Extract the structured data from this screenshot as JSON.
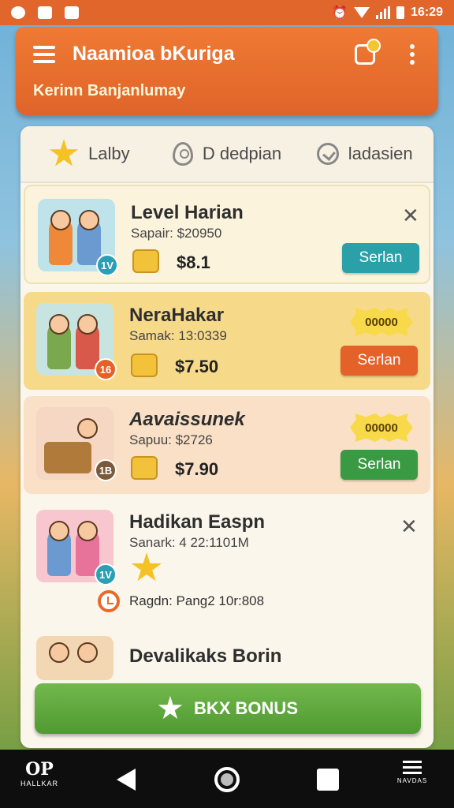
{
  "status_bar": {
    "time": "16:29"
  },
  "app_bar": {
    "title": "Naamioa bKuriga",
    "subtitle": "Kerinn Banjanlumay"
  },
  "tabs": [
    {
      "label": "Lalby",
      "icon": "star-icon"
    },
    {
      "label": "D dedpian",
      "icon": "location-pin-icon"
    },
    {
      "label": "ladasien",
      "icon": "shield-check-icon"
    }
  ],
  "items": [
    {
      "name": "Level Harian",
      "sub": "Sapair: $20950",
      "price": "$8.1",
      "level": "1V",
      "button": "Serlan",
      "colors": {
        "bg": "#fbf3dc",
        "button": "#2aa0a8",
        "level": "#2b9fb3"
      }
    },
    {
      "name": "NeraHakar",
      "sub": "Samak: 13:0339",
      "price": "$7.50",
      "level": "16",
      "badge": "00000",
      "button": "Serlan",
      "colors": {
        "bg": "#f7d98a",
        "button": "#e4622a",
        "level": "#e4622a"
      }
    },
    {
      "name": "Aavaissunek",
      "sub": "Sapuu: $2726",
      "price": "$7.90",
      "level": "1B",
      "badge": "00000",
      "button": "Serlan",
      "colors": {
        "bg": "#f9e0c6",
        "button": "#3a9a44",
        "level": "#7a5a3a"
      }
    },
    {
      "name": "Hadikan Easpn",
      "sub": "Sanark: 4 22:1101M",
      "timer": "Ragdn: Pang2 10r:808",
      "level": "1V",
      "colors": {
        "bg": "#fbf6ec",
        "level": "#2b9fb3"
      }
    },
    {
      "name": "Devalikaks Borin"
    }
  ],
  "bonus_button": {
    "label": "BKX BONUS"
  },
  "nav_bar": {
    "logo_text": "HALLKAR",
    "right_text": "NAVDAS"
  }
}
